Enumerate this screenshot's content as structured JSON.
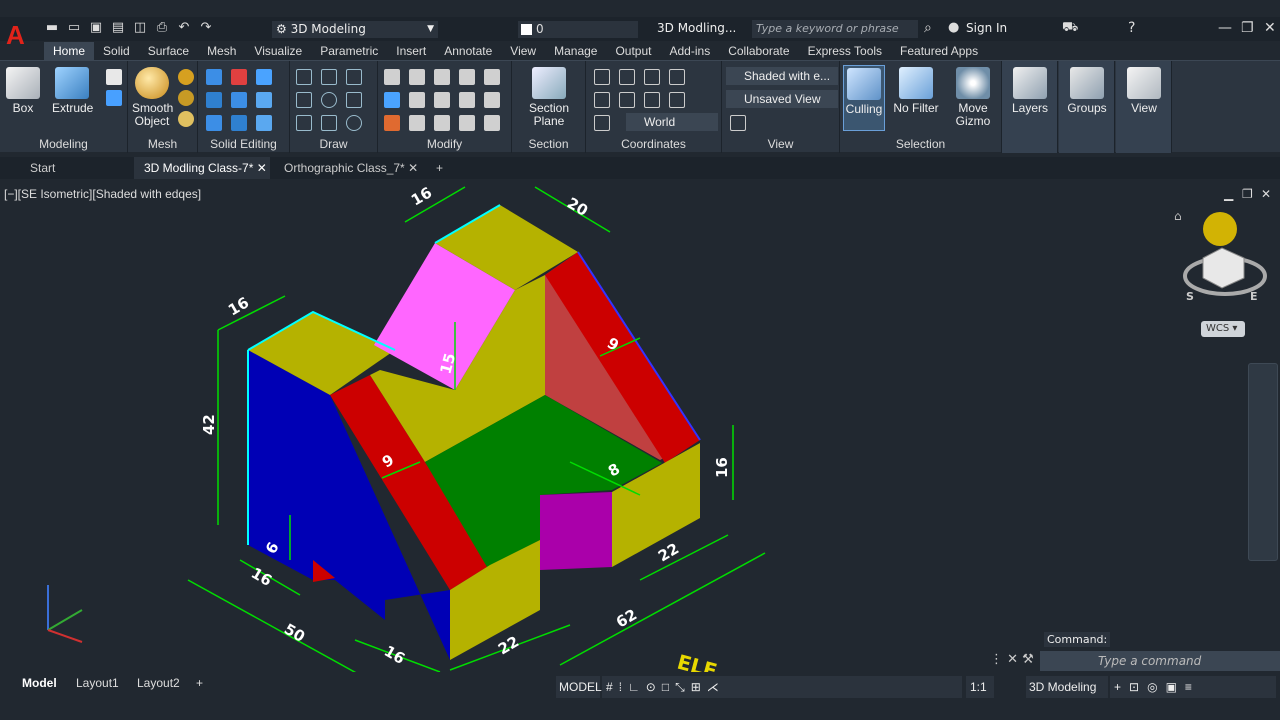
{
  "app": {
    "workspace": "3D Modeling",
    "layer": "0",
    "doc_title": "3D Modling...",
    "search_placeholder": "Type a keyword or phrase",
    "sign_in": "Sign In"
  },
  "menu_tabs": [
    "Home",
    "Solid",
    "Surface",
    "Mesh",
    "Visualize",
    "Parametric",
    "Insert",
    "Annotate",
    "View",
    "Manage",
    "Output",
    "Add-ins",
    "Collaborate",
    "Express Tools",
    "Featured Apps"
  ],
  "ribbon": {
    "box": "Box",
    "extrude": "Extrude",
    "smooth1": "Smooth",
    "smooth2": "Object",
    "section1": "Section",
    "section2": "Plane",
    "visual_style": "Shaded with e...",
    "view_state": "Unsaved View",
    "ucs": "World",
    "culling": "Culling",
    "no_filter": "No Filter",
    "move1": "Move",
    "move2": "Gizmo",
    "layers": "Layers",
    "groups": "Groups",
    "view": "View",
    "panels": [
      "Modeling",
      "Mesh",
      "Solid Editing",
      "Draw",
      "Modify",
      "Section",
      "Coordinates",
      "View",
      "Selection"
    ]
  },
  "doc_tabs": {
    "start": "Start",
    "tab1": "3D Modling Class-7*",
    "tab2": "Orthographic Class_7*"
  },
  "viewport": {
    "label": "[−][SE Isometric][Shaded with edqes]",
    "wcs": "WCS",
    "dims": [
      "16",
      "20",
      "16",
      "15",
      "9",
      "42",
      "9",
      "8",
      "16",
      "6",
      "16",
      "22",
      "50",
      "16",
      "22",
      "62"
    ]
  },
  "command": {
    "label": "Command:",
    "placeholder": "Type  a  command"
  },
  "status": {
    "model_tab": "Model",
    "layout1": "Layout1",
    "layout2": "Layout2",
    "model": "MODEL",
    "scale": "1:1",
    "workspace": "3D Modeling"
  },
  "colors": {
    "accent": "#0696d7",
    "face_yellow": "#b5b200",
    "face_blue": "#0000b5",
    "face_red": "#cc0000",
    "face_green": "#008000",
    "face_pink": "#ff66ff",
    "face_purple": "#aa00aa",
    "dim_green": "#00dd00"
  }
}
